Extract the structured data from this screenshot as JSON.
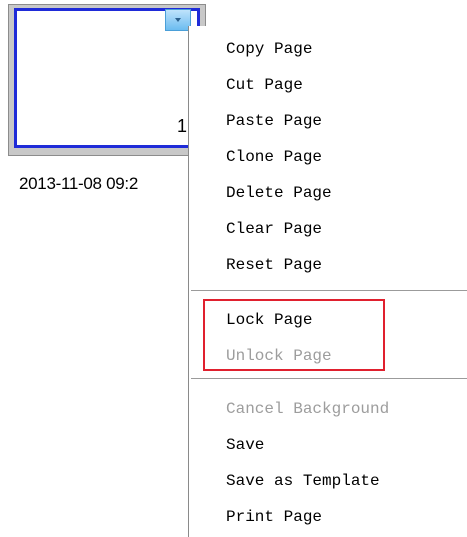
{
  "thumbnail": {
    "page_number": "1",
    "timestamp": "2013-11-08 09:2"
  },
  "menu": {
    "group1": [
      {
        "label": "Copy Page",
        "enabled": true
      },
      {
        "label": "Cut Page",
        "enabled": true
      },
      {
        "label": "Paste Page",
        "enabled": true
      },
      {
        "label": "Clone Page",
        "enabled": true
      },
      {
        "label": "Delete Page",
        "enabled": true
      },
      {
        "label": "Clear Page",
        "enabled": true
      },
      {
        "label": "Reset Page",
        "enabled": true
      }
    ],
    "group2": [
      {
        "label": "Lock Page",
        "enabled": true
      },
      {
        "label": "Unlock Page",
        "enabled": false
      }
    ],
    "group3": [
      {
        "label": "Cancel Background",
        "enabled": false
      },
      {
        "label": "Save",
        "enabled": true
      },
      {
        "label": "Save as Template",
        "enabled": true
      },
      {
        "label": "Print Page",
        "enabled": true
      }
    ]
  },
  "colors": {
    "thumbnail_border": "#1f2bd8",
    "highlight": "#e0202e",
    "disabled_text": "#9d9d9d"
  }
}
